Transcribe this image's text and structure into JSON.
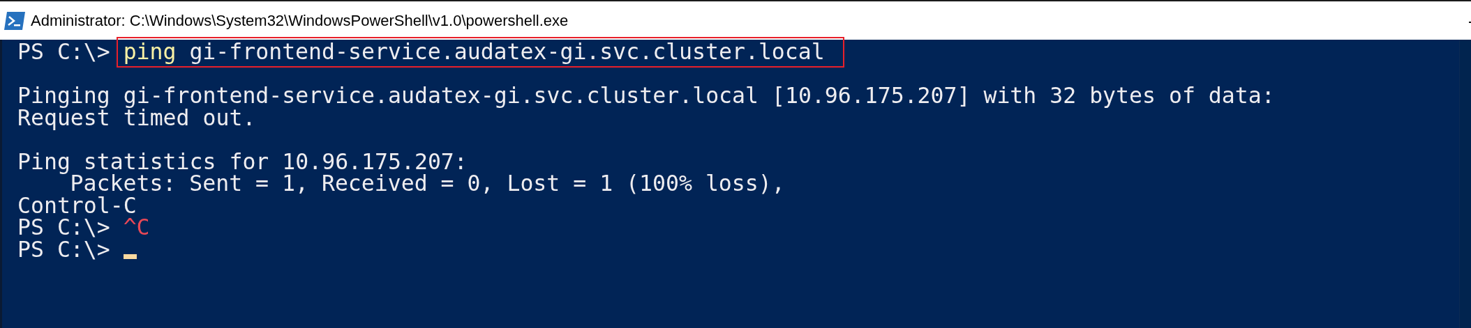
{
  "window": {
    "title": "Administrator: C:\\Windows\\System32\\WindowsPowerShell\\v1.0\\powershell.exe"
  },
  "console": {
    "lines": [
      {
        "kind": "text",
        "highlighted": true,
        "segments": [
          {
            "kind": "prompt",
            "text": "PS C:\\>"
          },
          {
            "kind": "verb",
            "text": "ping"
          },
          {
            "kind": "arg",
            "text": "gi-frontend-service.audatex-gi.svc.cluster.local"
          }
        ]
      },
      {
        "kind": "blank"
      },
      {
        "kind": "text",
        "highlighted": false,
        "segments": [
          {
            "kind": "output",
            "text": "Pinging gi-frontend-service.audatex-gi.svc.cluster.local [10.96.175.207] with 32 bytes of data:"
          }
        ]
      },
      {
        "kind": "text",
        "highlighted": false,
        "segments": [
          {
            "kind": "output",
            "text": "Request timed out."
          }
        ]
      },
      {
        "kind": "blank"
      },
      {
        "kind": "text",
        "highlighted": false,
        "segments": [
          {
            "kind": "output",
            "text": "Ping statistics for 10.96.175.207:"
          }
        ]
      },
      {
        "kind": "text",
        "highlighted": false,
        "segments": [
          {
            "kind": "indented",
            "text": "Packets: Sent = 1, Received = 0, Lost = 1 (100% loss),"
          }
        ]
      },
      {
        "kind": "text",
        "highlighted": false,
        "segments": [
          {
            "kind": "output",
            "text": "Control-C"
          }
        ]
      },
      {
        "kind": "text",
        "highlighted": false,
        "segments": [
          {
            "kind": "prompt",
            "text": "PS C:\\>"
          },
          {
            "kind": "interrupt",
            "text": "^C"
          }
        ]
      },
      {
        "kind": "text",
        "highlighted": false,
        "segments": [
          {
            "kind": "prompt",
            "text": "PS C:\\>"
          },
          {
            "kind": "cursor"
          }
        ]
      }
    ]
  }
}
